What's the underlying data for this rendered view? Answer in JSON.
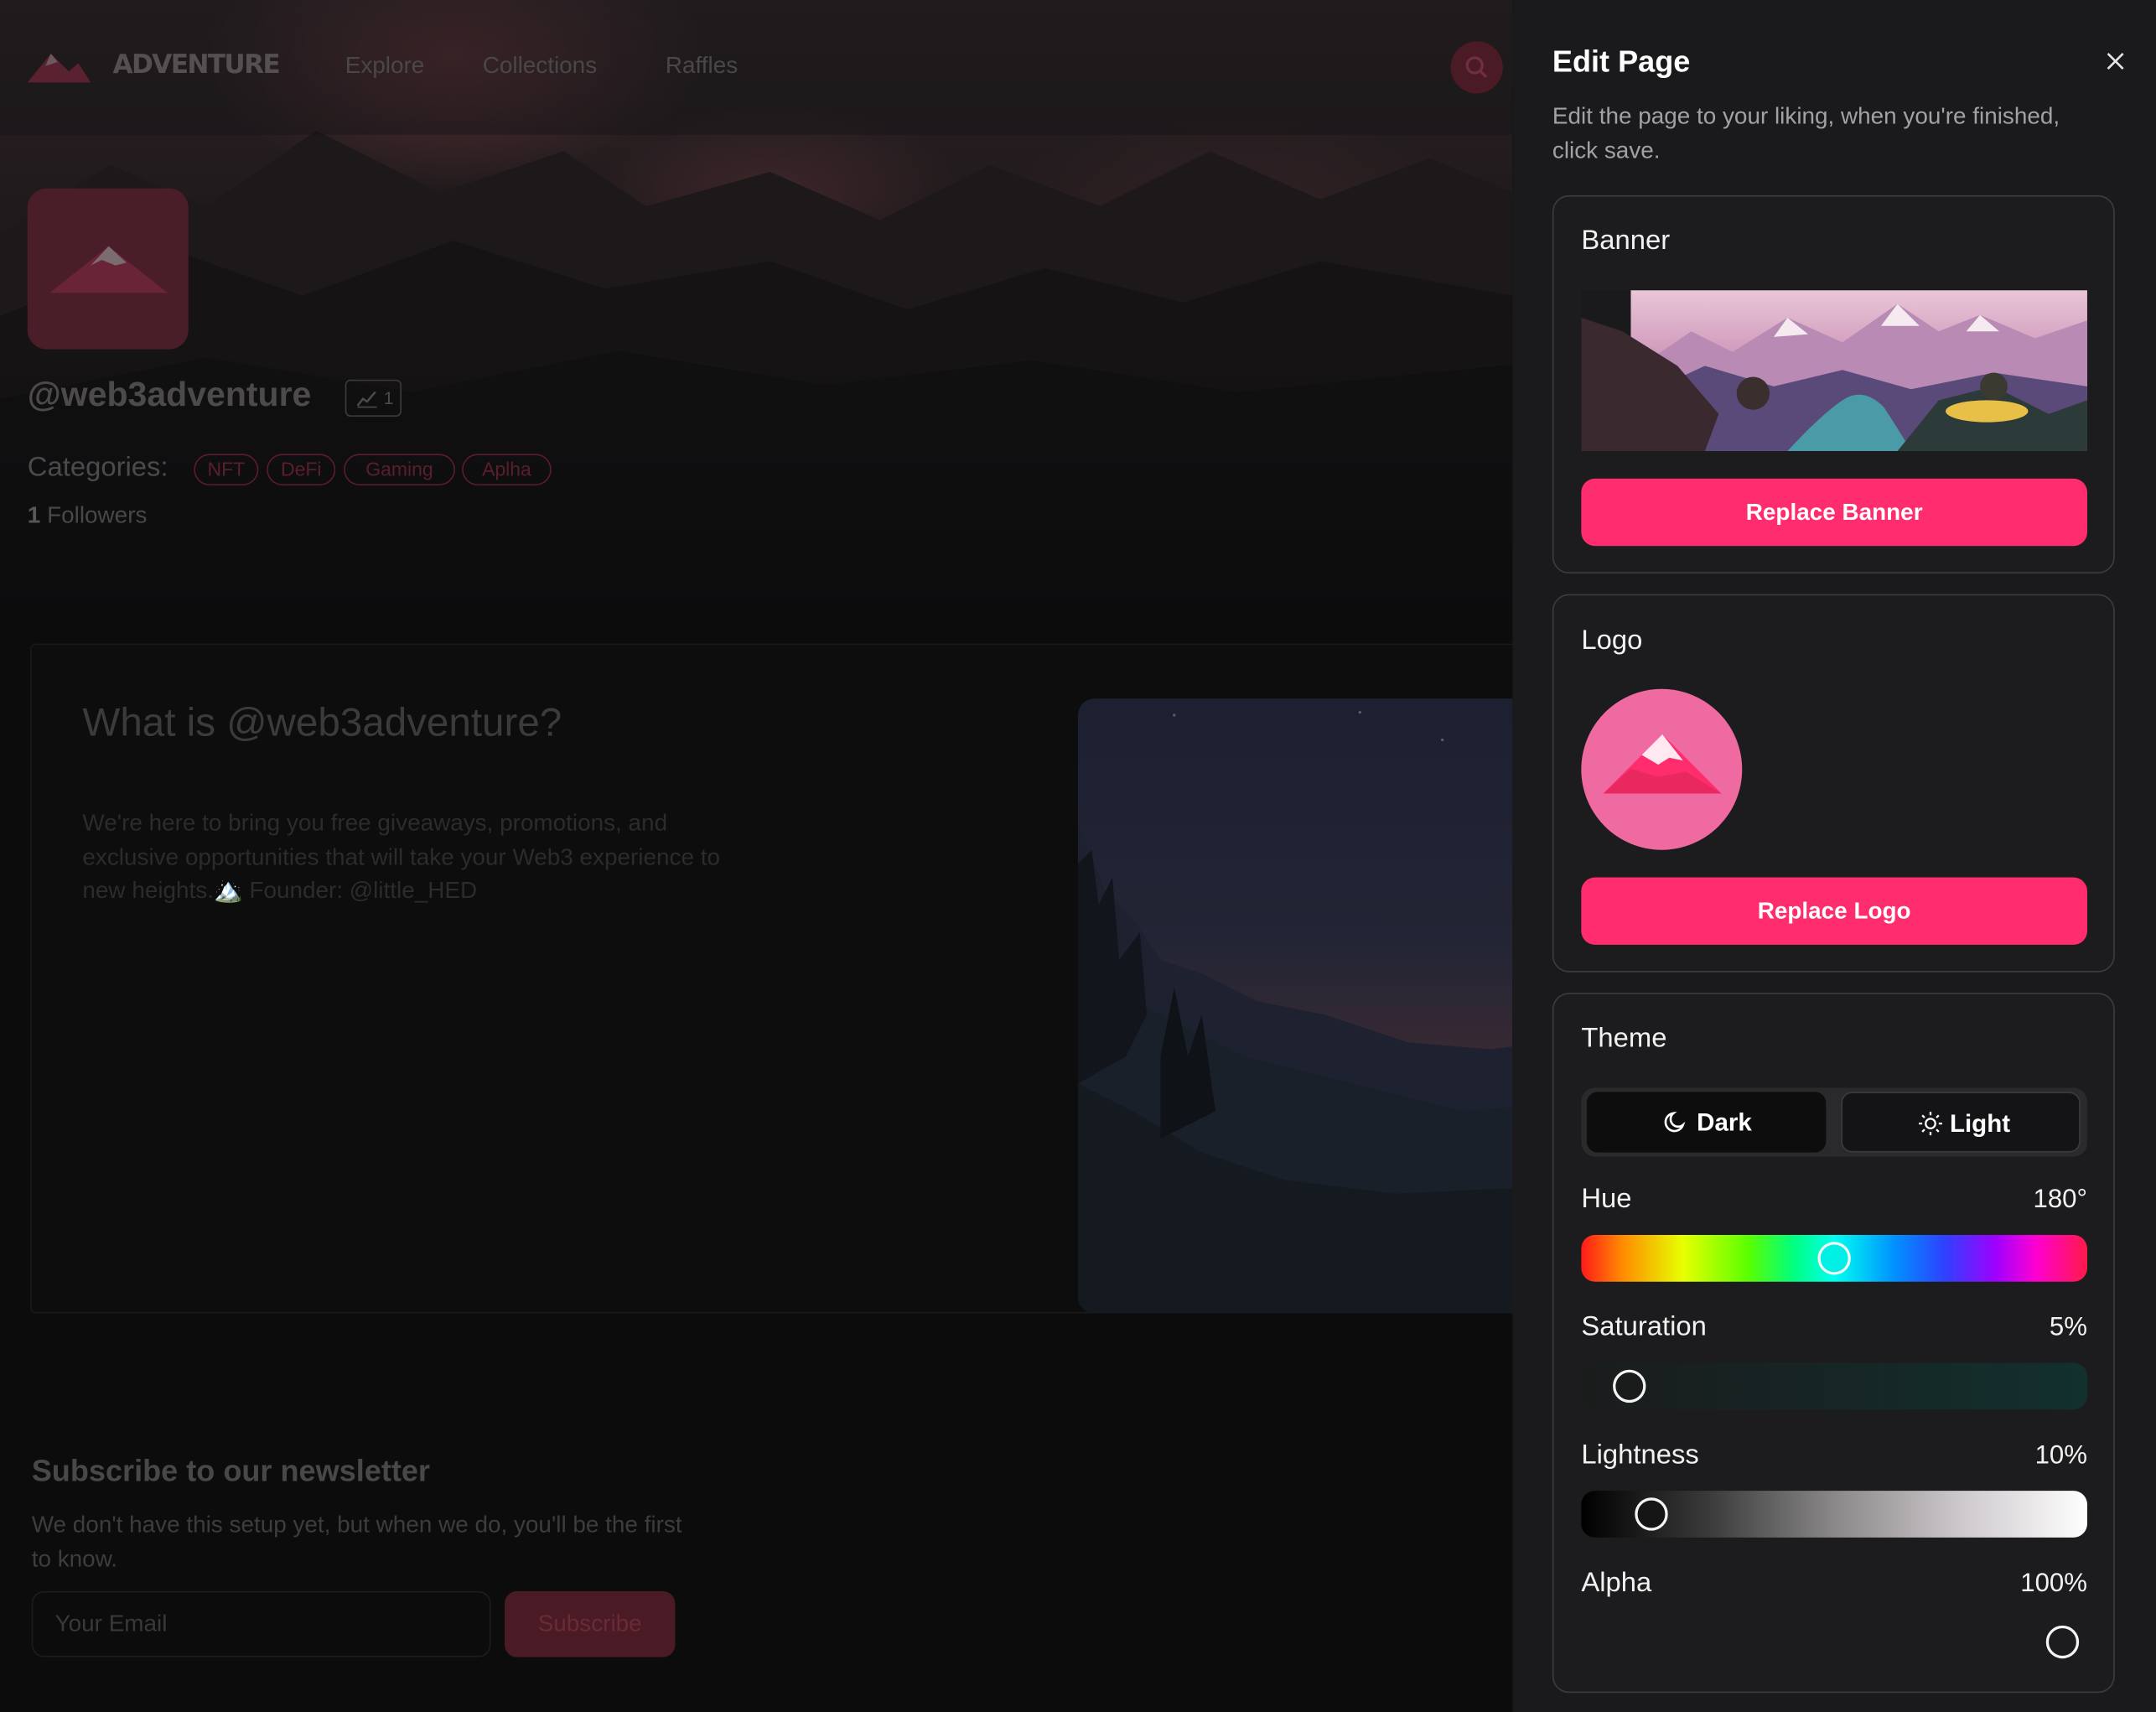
{
  "nav": {
    "brand": "ADVENTURE",
    "links": [
      "Explore",
      "Collections",
      "Raffles"
    ]
  },
  "profile": {
    "handle": "@web3adventure",
    "stat_count": "1",
    "categories_label": "Categories:",
    "tags": [
      "NFT",
      "DeFi",
      "Gaming",
      "Aplha"
    ],
    "followers_count": "1",
    "followers_label": "Followers"
  },
  "about": {
    "title": "What is @web3adventure?",
    "text": "We're here to bring you free giveaways, promotions, and exclusive opportunities that will take your Web3 experience to new heights.🏔️ Founder: @little_HED"
  },
  "newsletter": {
    "title": "Subscribe to our newsletter",
    "text": "We don't have this setup yet, but when we do, you'll be the first to know.",
    "email_placeholder": "Your Email",
    "subscribe_label": "Subscribe"
  },
  "panel": {
    "title": "Edit Page",
    "description": "Edit the page to your liking, when you're finished, click save.",
    "banner": {
      "label": "Banner",
      "button": "Replace Banner"
    },
    "logo": {
      "label": "Logo",
      "button": "Replace Logo"
    },
    "theme": {
      "label": "Theme",
      "dark_label": "Dark",
      "light_label": "Light",
      "selected": "Dark",
      "hue": {
        "label": "Hue",
        "value_text": "180°",
        "value": 180,
        "max": 360
      },
      "saturation": {
        "label": "Saturation",
        "value_text": "5%",
        "value": 5,
        "max": 100
      },
      "lightness": {
        "label": "Lightness",
        "value_text": "10%",
        "value": 10,
        "max": 100
      },
      "alpha": {
        "label": "Alpha",
        "value_text": "100%",
        "value": 100,
        "max": 100
      }
    }
  },
  "colors": {
    "accent": "#ff2d6e",
    "panel_bg": "#1a1a1c",
    "logo_bg": "#ef6aa0"
  },
  "icons": [
    "mountain-logo-icon",
    "search-icon",
    "chart-icon",
    "close-icon",
    "moon-icon",
    "sun-icon"
  ]
}
